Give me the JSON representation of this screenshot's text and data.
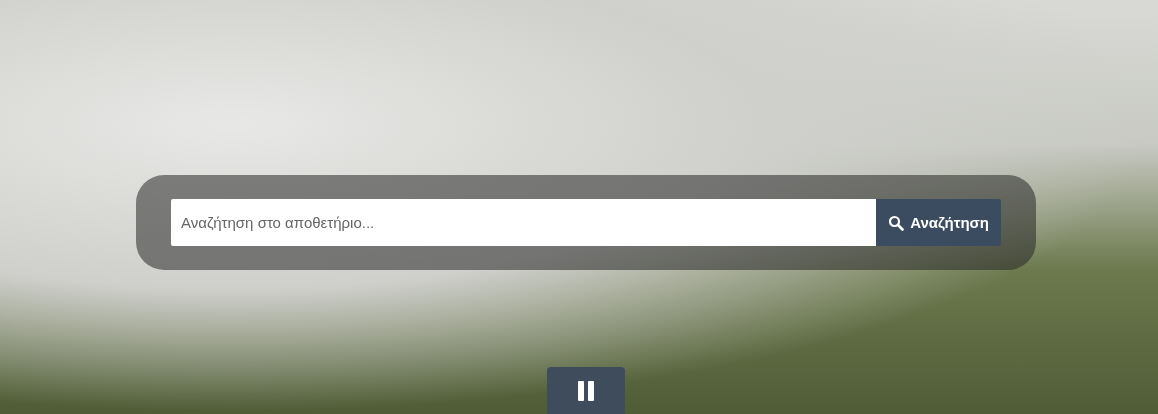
{
  "search": {
    "placeholder": "Αναζήτηση στο αποθετήριο...",
    "button": "Αναζήτηση"
  },
  "slideshow": {
    "playing": true
  }
}
